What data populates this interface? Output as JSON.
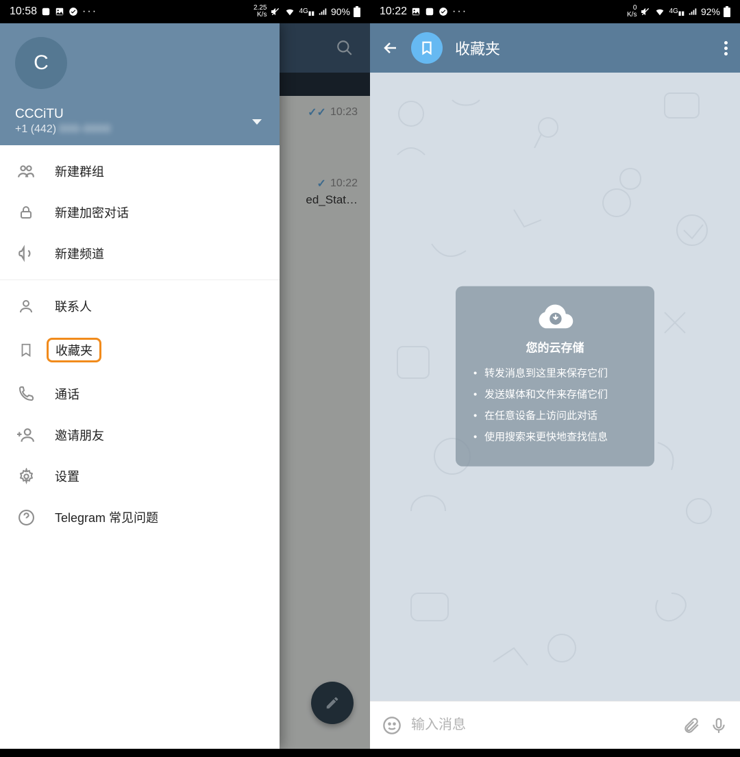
{
  "screen1": {
    "status": {
      "time": "10:58",
      "net_speed": "2.25",
      "net_unit": "K/s",
      "battery": "90%"
    },
    "chat_list": {
      "row1_time": "10:23",
      "row2_time": "10:22",
      "row2_file": "ed_Stat…"
    },
    "drawer": {
      "avatar_letter": "C",
      "username": "CCCiTU",
      "phone_prefix": "+1 (442) ",
      "phone_blurred": "000-0000",
      "items_top": [
        "新建群组",
        "新建加密对话",
        "新建频道"
      ],
      "items_bottom": [
        "联系人",
        "收藏夹",
        "通话",
        "邀请朋友",
        "设置",
        "Telegram 常见问题"
      ]
    }
  },
  "screen2": {
    "status": {
      "time": "10:22",
      "net_speed": "0",
      "net_unit": "K/s",
      "battery": "92%"
    },
    "header_title": "收藏夹",
    "info": {
      "title": "您的云存储",
      "items": [
        "转发消息到这里来保存它们",
        "发送媒体和文件来存储它们",
        "在任意设备上访问此对话",
        "使用搜索来更快地查找信息"
      ]
    },
    "input_placeholder": "输入消息"
  }
}
